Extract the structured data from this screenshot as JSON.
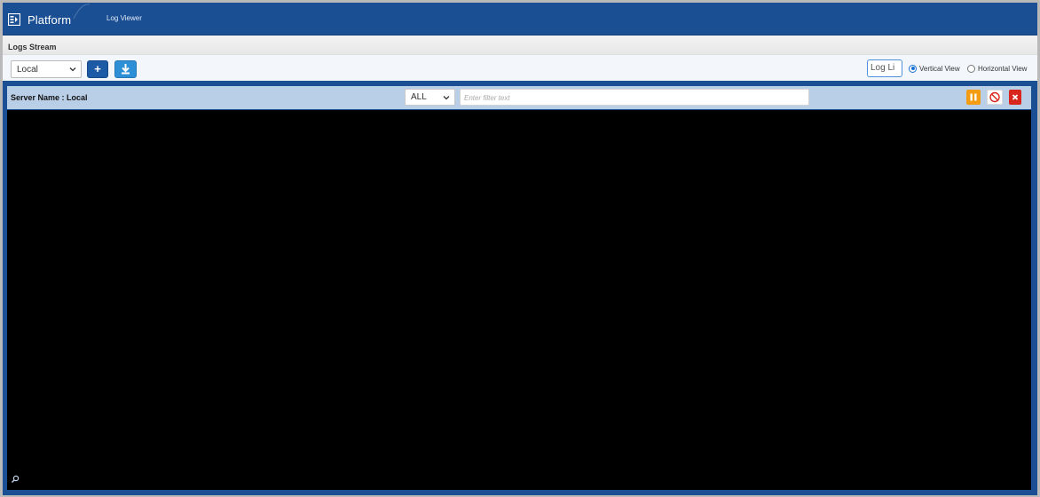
{
  "navbar": {
    "brand": "Platform",
    "nav_link": "Log Viewer"
  },
  "section": {
    "title": "Logs Stream"
  },
  "toolbar": {
    "server_select_value": "Local",
    "add_label": "+",
    "log_lines_value": "Log Li",
    "view_options": [
      {
        "label": "Vertical View",
        "checked": true
      },
      {
        "label": "Horizontal View",
        "checked": false
      }
    ]
  },
  "panel": {
    "server_name": "Server Name : Local",
    "level_value": "ALL",
    "filter_placeholder": "Enter filter text"
  },
  "colors": {
    "navbar": "#1b4f93",
    "panel_header": "#b9cfe8",
    "console": "#000000",
    "pause": "#f39c12",
    "close": "#d9261c",
    "add_button": "#1c5aa6",
    "download_button": "#2d8fd5"
  },
  "icons": [
    "platform-logo-icon",
    "chevron-down-icon",
    "download-icon",
    "pause-icon",
    "clear-icon",
    "close-icon",
    "zoom-icon"
  ]
}
